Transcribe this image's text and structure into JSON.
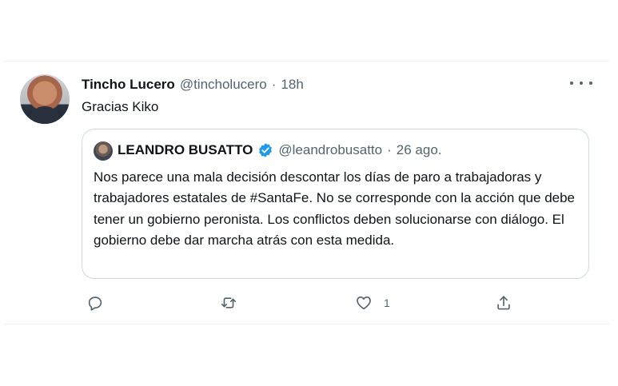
{
  "tweet": {
    "author_name": "Tincho Lucero",
    "author_handle": "@tincholucero",
    "separator": "·",
    "time": "18h",
    "text": "Gracias Kiko"
  },
  "quoted": {
    "author_name": "LEANDRO BUSATTO",
    "author_handle": "@leandrobusatto",
    "separator": "·",
    "time": "26 ago.",
    "verified": true,
    "text": "Nos parece una mala decisión descontar los días de paro a trabajadoras y trabajadores estatales de #SantaFe. No se corresponde con la acción que debe tener un gobierno peronista. Los conflictos deben solucionarse con diálogo. El gobierno debe dar marcha atrás con esta medida."
  },
  "actions": {
    "reply_icon": "reply-icon",
    "retweet_icon": "retweet-icon",
    "like_icon": "heart-icon",
    "like_count": "1",
    "share_icon": "share-icon"
  },
  "colors": {
    "text": "#0f1419",
    "secondary": "#536471",
    "border": "#cfd9de",
    "verified": "#1d9bf0"
  }
}
